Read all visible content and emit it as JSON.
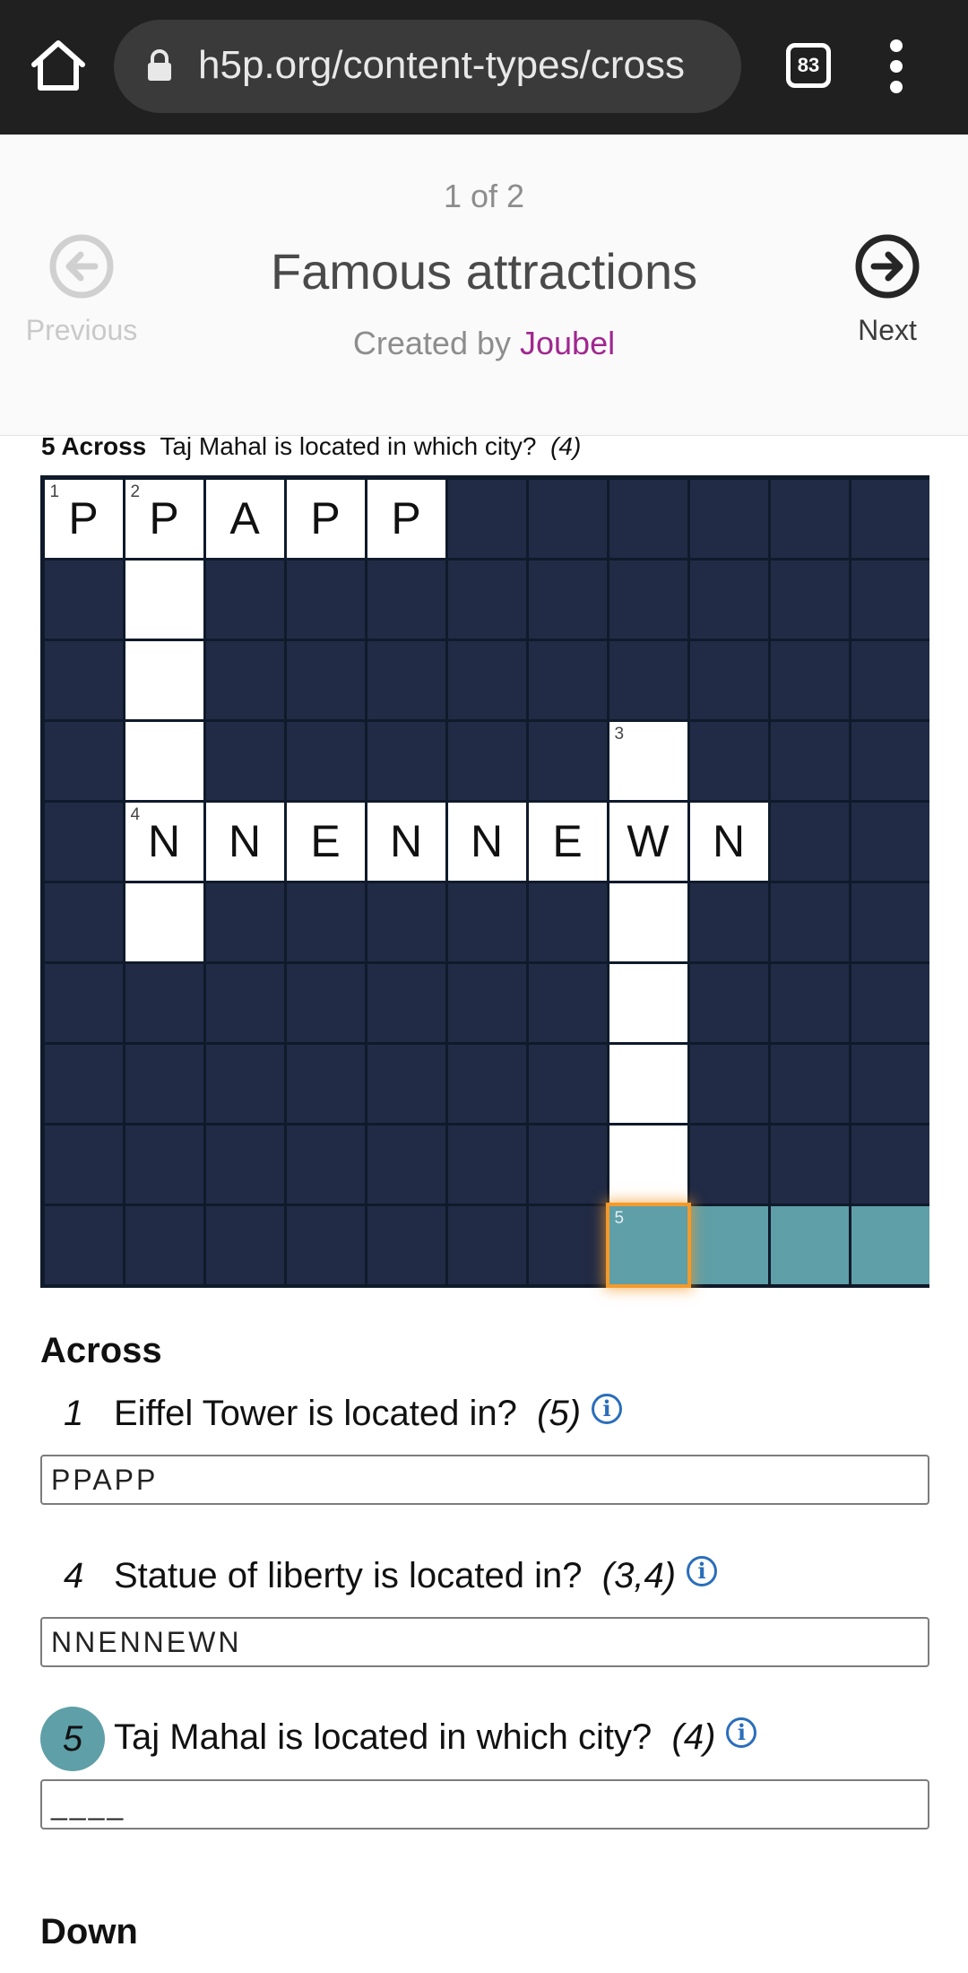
{
  "browser": {
    "url": "h5p.org/content-types/cross",
    "tab_count": "83"
  },
  "header": {
    "pager": "1 of 2",
    "title": "Famous attractions",
    "created_by": "Created by",
    "author": "Joubel",
    "prev_label": "Previous",
    "next_label": "Next"
  },
  "current_clue": {
    "label": "5 Across",
    "text": "Taj Mahal is located in which city?",
    "length": "(4)"
  },
  "grid": {
    "rows": 10,
    "cols": 11,
    "cells": [
      {
        "r": 0,
        "c": 0,
        "num": "1",
        "ch": "P",
        "state": "open"
      },
      {
        "r": 0,
        "c": 1,
        "num": "2",
        "ch": "P",
        "state": "open"
      },
      {
        "r": 0,
        "c": 2,
        "ch": "A",
        "state": "open"
      },
      {
        "r": 0,
        "c": 3,
        "ch": "P",
        "state": "open"
      },
      {
        "r": 0,
        "c": 4,
        "ch": "P",
        "state": "open"
      },
      {
        "r": 1,
        "c": 1,
        "state": "open"
      },
      {
        "r": 2,
        "c": 1,
        "state": "open"
      },
      {
        "r": 3,
        "c": 1,
        "state": "open"
      },
      {
        "r": 3,
        "c": 7,
        "num": "3",
        "state": "open"
      },
      {
        "r": 4,
        "c": 1,
        "num": "4",
        "ch": "N",
        "state": "open"
      },
      {
        "r": 4,
        "c": 2,
        "ch": "N",
        "state": "open"
      },
      {
        "r": 4,
        "c": 3,
        "ch": "E",
        "state": "open"
      },
      {
        "r": 4,
        "c": 4,
        "ch": "N",
        "state": "open"
      },
      {
        "r": 4,
        "c": 5,
        "ch": "N",
        "state": "open"
      },
      {
        "r": 4,
        "c": 6,
        "ch": "E",
        "state": "open"
      },
      {
        "r": 4,
        "c": 7,
        "ch": "W",
        "state": "open"
      },
      {
        "r": 4,
        "c": 8,
        "ch": "N",
        "state": "open"
      },
      {
        "r": 5,
        "c": 1,
        "state": "open"
      },
      {
        "r": 5,
        "c": 7,
        "state": "open"
      },
      {
        "r": 6,
        "c": 7,
        "state": "open"
      },
      {
        "r": 7,
        "c": 7,
        "state": "open"
      },
      {
        "r": 8,
        "c": 7,
        "state": "open"
      },
      {
        "r": 9,
        "c": 7,
        "num": "5",
        "state": "focus"
      },
      {
        "r": 9,
        "c": 8,
        "state": "hl"
      },
      {
        "r": 9,
        "c": 9,
        "state": "hl"
      },
      {
        "r": 9,
        "c": 10,
        "state": "hl"
      }
    ]
  },
  "across": {
    "heading": "Across",
    "clues": [
      {
        "num": "1",
        "text": "Eiffel Tower is located in?",
        "length": "(5)",
        "answer": "PPAPP",
        "active": false
      },
      {
        "num": "4",
        "text": "Statue of liberty is located in?",
        "length": "(3,4)",
        "answer": "NNENNEWN",
        "active": false
      },
      {
        "num": "5",
        "text": "Taj Mahal is located in which city?",
        "length": "(4)",
        "answer": "____",
        "active": true
      }
    ]
  },
  "down": {
    "heading": "Down"
  }
}
